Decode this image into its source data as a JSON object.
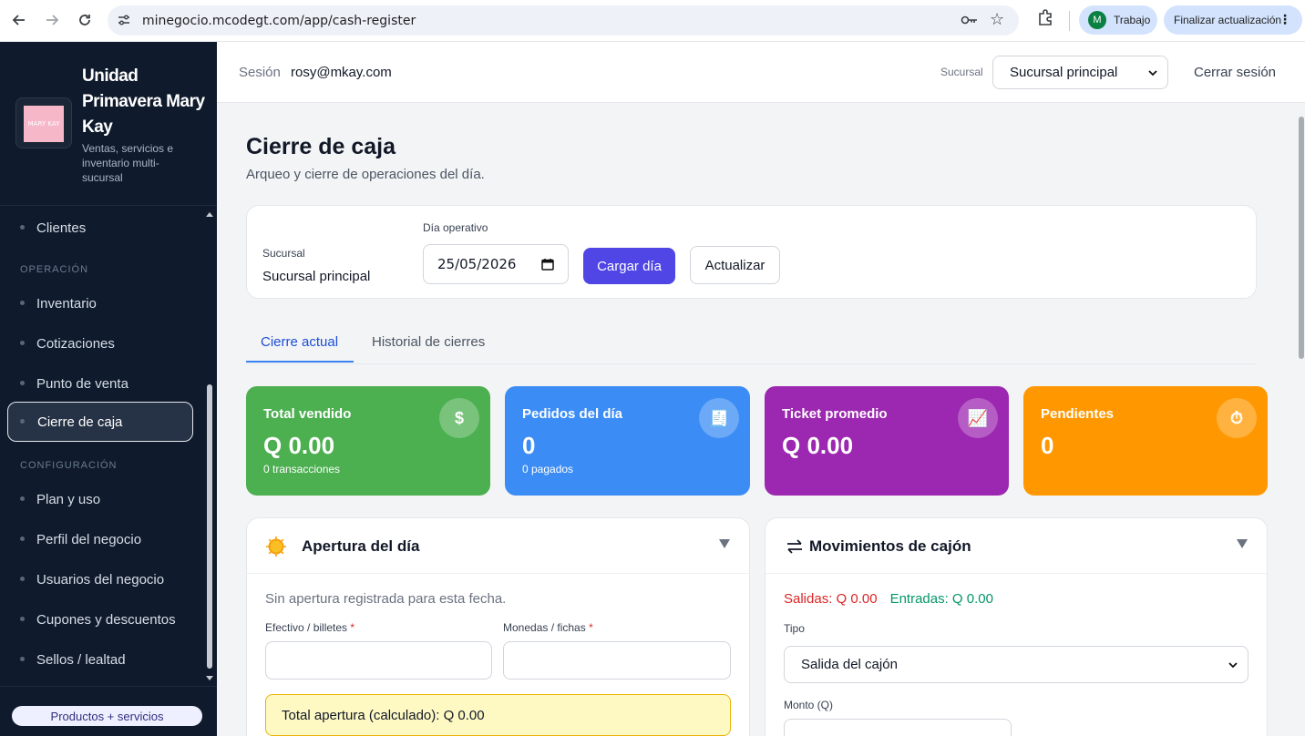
{
  "browser": {
    "url": "minegocio.mcodegt.com/app/cash-register",
    "profile_initial": "M",
    "profile_label": "Trabajo",
    "update_label": "Finalizar actualización"
  },
  "sidebar": {
    "logo_text": "MARY KAY",
    "brand_title": "Unidad Primavera Mary Kay",
    "brand_subtitle": "Ventas, servicios e inventario multi-sucursal",
    "items_top": [
      {
        "label": "Clientes"
      }
    ],
    "section_operation": "OPERACIÓN",
    "items_operation": [
      {
        "label": "Inventario"
      },
      {
        "label": "Cotizaciones"
      },
      {
        "label": "Punto de venta"
      },
      {
        "label": "Cierre de caja",
        "active": true
      }
    ],
    "section_config": "CONFIGURACIÓN",
    "items_config": [
      {
        "label": "Plan y uso"
      },
      {
        "label": "Perfil del negocio"
      },
      {
        "label": "Usuarios del negocio"
      },
      {
        "label": "Cupones y descuentos"
      },
      {
        "label": "Sellos / lealtad"
      }
    ],
    "bottom_button": "Productos + servicios"
  },
  "topbar": {
    "session_label": "Sesión",
    "session_email": "rosy@mkay.com",
    "branch_label": "Sucursal",
    "branch_selected": "Sucursal principal",
    "logout": "Cerrar sesión"
  },
  "page": {
    "title": "Cierre de caja",
    "subtitle": "Arqueo y cierre de operaciones del día."
  },
  "filters": {
    "branch_label": "Sucursal",
    "branch_value": "Sucursal principal",
    "day_label": "Día operativo",
    "day_value": "25/05/2026",
    "load_button": "Cargar día",
    "refresh_button": "Actualizar"
  },
  "tabs": [
    {
      "label": "Cierre actual",
      "active": true
    },
    {
      "label": "Historial de cierres",
      "active": false
    }
  ],
  "kpis": [
    {
      "label": "Total vendido",
      "value": "Q 0.00",
      "sub": "0 transacciones",
      "icon": "dollar-icon",
      "icon_glyph": "$",
      "color": "#4caf50"
    },
    {
      "label": "Pedidos del día",
      "value": "0",
      "sub": "0 pagados",
      "icon": "receipt-icon",
      "icon_glyph": "🧾",
      "color": "#3b8cf5"
    },
    {
      "label": "Ticket promedio",
      "value": "Q 0.00",
      "sub": "",
      "icon": "chart-icon",
      "icon_glyph": "📈",
      "color": "#9c27b0"
    },
    {
      "label": "Pendientes",
      "value": "0",
      "sub": "",
      "icon": "stopwatch-icon",
      "icon_glyph": "⏱",
      "color": "#ff9800"
    }
  ],
  "opening_panel": {
    "title": "Apertura del día",
    "note": "Sin apertura registrada para esta fecha.",
    "cash_label": "Efectivo / billetes",
    "coins_label": "Monedas / fichas",
    "required_mark": "*",
    "total_label": "Total apertura (calculado): Q 0.00"
  },
  "movements_panel": {
    "title": "Movimientos de cajón",
    "outflows": "Salidas: Q 0.00",
    "inflows": "Entradas: Q 0.00",
    "type_label": "Tipo",
    "type_selected": "Salida del cajón",
    "amount_label": "Monto (Q)"
  }
}
